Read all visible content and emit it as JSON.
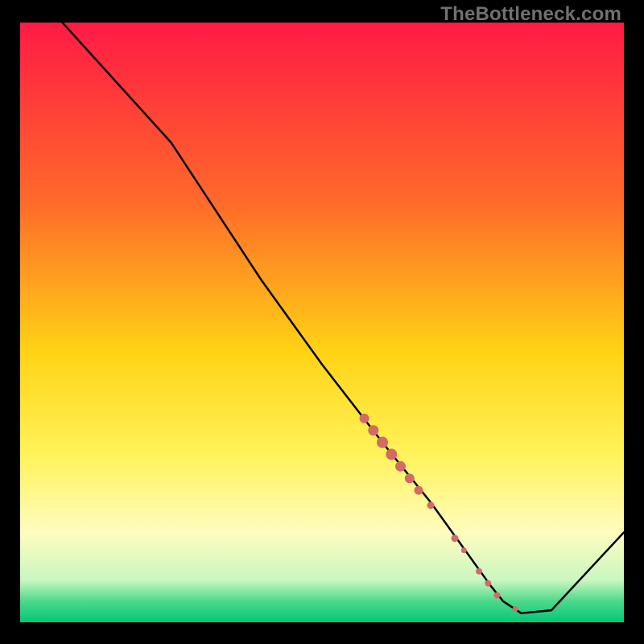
{
  "watermark": "TheBottleneck.com",
  "chart_data": {
    "type": "line",
    "title": "",
    "xlabel": "",
    "ylabel": "",
    "xlim": [
      0,
      100
    ],
    "ylim": [
      0,
      100
    ],
    "grid": false,
    "gradient_stops": [
      {
        "offset": 0.0,
        "color": "#ff1a45"
      },
      {
        "offset": 0.3,
        "color": "#ff6a2a"
      },
      {
        "offset": 0.55,
        "color": "#ffd315"
      },
      {
        "offset": 0.72,
        "color": "#fff35a"
      },
      {
        "offset": 0.85,
        "color": "#fffcbf"
      },
      {
        "offset": 0.93,
        "color": "#c9f7c0"
      },
      {
        "offset": 0.965,
        "color": "#4cd98a"
      },
      {
        "offset": 1.0,
        "color": "#00c878"
      }
    ],
    "series": [
      {
        "name": "bottleneck-curve",
        "color": "#000000",
        "width": 2.5,
        "x": [
          0,
          7,
          25,
          40,
          50,
          60,
          68,
          73,
          78,
          80,
          83,
          88,
          100
        ],
        "y": [
          105,
          100,
          80,
          57,
          43,
          30,
          20,
          13,
          6,
          3.5,
          1.5,
          2,
          15
        ]
      }
    ],
    "scatter": {
      "name": "data-points",
      "color": "#d36a65",
      "points": [
        {
          "x": 57,
          "y": 34,
          "r": 6
        },
        {
          "x": 58.5,
          "y": 32,
          "r": 6.5
        },
        {
          "x": 60,
          "y": 30,
          "r": 7
        },
        {
          "x": 61.5,
          "y": 28,
          "r": 7
        },
        {
          "x": 63,
          "y": 26,
          "r": 6.5
        },
        {
          "x": 64.5,
          "y": 24,
          "r": 6
        },
        {
          "x": 66,
          "y": 22,
          "r": 5.5
        },
        {
          "x": 68,
          "y": 19.5,
          "r": 4.5
        },
        {
          "x": 72,
          "y": 14,
          "r": 4.5
        },
        {
          "x": 73.5,
          "y": 12,
          "r": 3.5
        },
        {
          "x": 76,
          "y": 8.5,
          "r": 4
        },
        {
          "x": 77.5,
          "y": 6.5,
          "r": 4
        },
        {
          "x": 79,
          "y": 4.5,
          "r": 4
        },
        {
          "x": 82,
          "y": 2.2,
          "r": 3.5
        }
      ]
    }
  }
}
